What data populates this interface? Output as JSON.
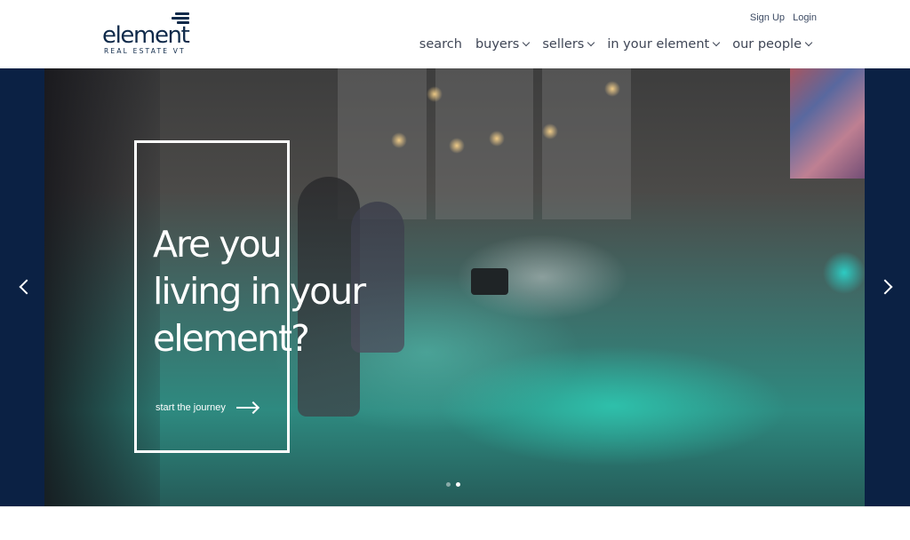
{
  "brand": {
    "name": "element",
    "tagline": "REAL ESTATE VT",
    "color": "#0f2a4a"
  },
  "account": {
    "signup": "Sign Up",
    "login": "Login"
  },
  "nav": {
    "items": [
      {
        "label": "search",
        "has_dropdown": false
      },
      {
        "label": "buyers",
        "has_dropdown": true
      },
      {
        "label": "sellers",
        "has_dropdown": true
      },
      {
        "label": "in your element",
        "has_dropdown": true
      },
      {
        "label": "our people",
        "has_dropdown": true
      }
    ],
    "icons": {
      "dropdown": "chevron-down-icon"
    }
  },
  "hero": {
    "headline_lines": [
      "Are you",
      "living in your",
      "element?"
    ],
    "cta_label": "start the journey",
    "cta_icon": "arrow-right-icon",
    "prev_icon": "chevron-left-icon",
    "next_icon": "chevron-right-icon",
    "slides_total": 2,
    "active_slide": 2,
    "side_color": "#0b2144"
  }
}
